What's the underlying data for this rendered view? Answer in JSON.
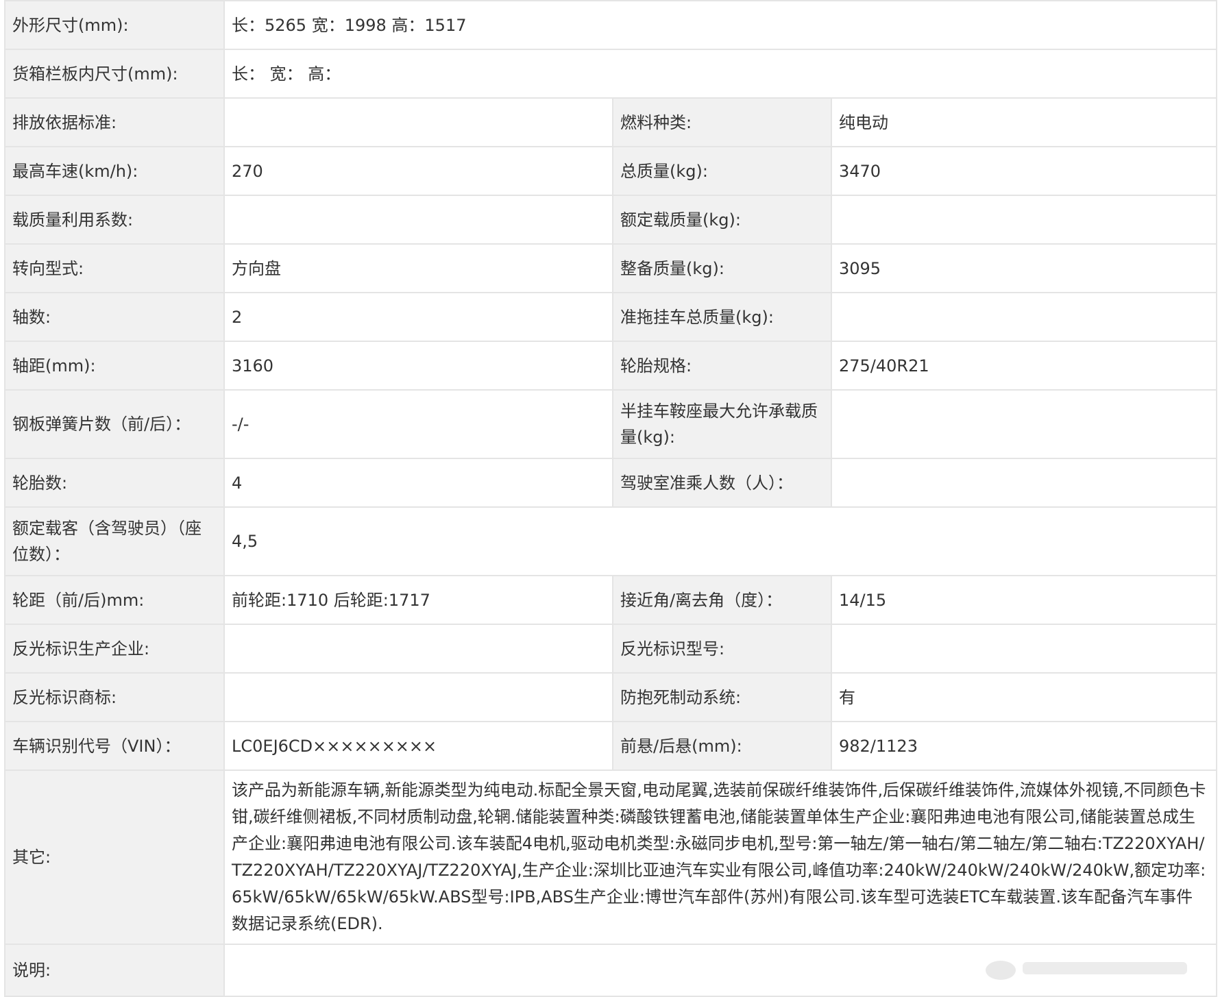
{
  "rows": [
    {
      "l1": "外形尺寸(mm):",
      "v1": "长：5265 宽：1998 高：1517"
    },
    {
      "l1": "货箱栏板内尺寸(mm):",
      "v1": "长：  宽：  高："
    },
    {
      "l1": "排放依据标准:",
      "v1": "",
      "l2": "燃料种类:",
      "v2": "纯电动"
    },
    {
      "l1": "最高车速(km/h):",
      "v1": "270",
      "l2": "总质量(kg):",
      "v2": "3470"
    },
    {
      "l1": "载质量利用系数:",
      "v1": "",
      "l2": "额定载质量(kg):",
      "v2": ""
    },
    {
      "l1": "转向型式:",
      "v1": "方向盘",
      "l2": "整备质量(kg):",
      "v2": "3095"
    },
    {
      "l1": "轴数:",
      "v1": "2",
      "l2": "准拖挂车总质量(kg):",
      "v2": ""
    },
    {
      "l1": "轴距(mm):",
      "v1": "3160",
      "l2": "轮胎规格:",
      "v2": "275/40R21"
    },
    {
      "l1": "钢板弹簧片数（前/后）：",
      "v1": "-/-",
      "l2": "半挂车鞍座最大允许承载质量(kg):",
      "v2": ""
    },
    {
      "l1": "轮胎数:",
      "v1": "4",
      "l2": "驾驶室准乘人数（人）：",
      "v2": ""
    },
    {
      "l1": "额定载客（含驾驶员）（座位数）：",
      "v1": "4,5"
    },
    {
      "l1": "轮距（前/后)mm:",
      "v1": "前轮距:1710 后轮距:1717",
      "l2": "接近角/离去角（度）：",
      "v2": "14/15"
    },
    {
      "l1": "反光标识生产企业:",
      "v1": "",
      "l2": "反光标识型号:",
      "v2": ""
    },
    {
      "l1": "反光标识商标:",
      "v1": "",
      "l2": "防抱死制动系统:",
      "v2": "有"
    },
    {
      "l1": "车辆识别代号（VIN）：",
      "v1": "LC0EJ6CD×××××××××",
      "l2": "前悬/后悬(mm):",
      "v2": "982/1123"
    },
    {
      "l1": "其它:",
      "v1": "该产品为新能源车辆,新能源类型为纯电动.标配全景天窗,电动尾翼,选装前保碳纤维装饰件,后保碳纤维装饰件,流媒体外视镜,不同颜色卡钳,碳纤维侧裙板,不同材质制动盘,轮辋.储能装置种类:磷酸铁锂蓄电池,储能装置单体生产企业:襄阳弗迪电池有限公司,储能装置总成生产企业:襄阳弗迪电池有限公司.该车装配4电机,驱动电机类型:永磁同步电机,型号:第一轴左/第一轴右/第二轴左/第二轴右:TZ220XYAH/TZ220XYAH/TZ220XYAJ/TZ220XYAJ,生产企业:深圳比亚迪汽车实业有限公司,峰值功率:240kW/240kW/240kW/240kW,额定功率:65kW/65kW/65kW/65kW.ABS型号:IPB,ABS生产企业:博世汽车部件(苏州)有限公司.该车型可选装ETC车载装置.该车配备汽车事件数据记录系统(EDR)."
    },
    {
      "l1": "说明:",
      "v1": ""
    }
  ]
}
